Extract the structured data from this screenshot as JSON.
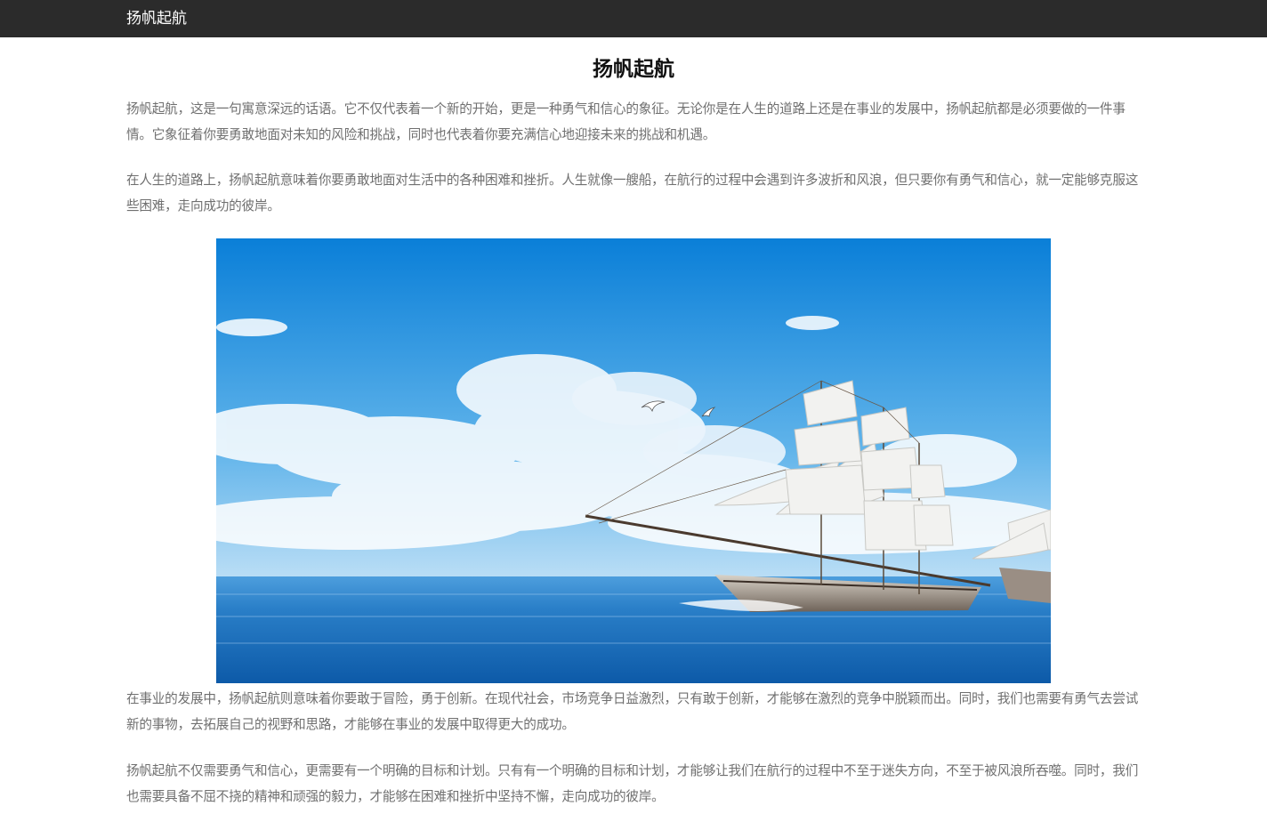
{
  "header": {
    "brand": "扬帆起航"
  },
  "article": {
    "title": "扬帆起航",
    "paragraphs": [
      "扬帆起航，这是一句寓意深远的话语。它不仅代表着一个新的开始，更是一种勇气和信心的象征。无论你是在人生的道路上还是在事业的发展中，扬帆起航都是必须要做的一件事情。它象征着你要勇敢地面对未知的风险和挑战，同时也代表着你要充满信心地迎接未来的挑战和机遇。",
      "在人生的道路上，扬帆起航意味着你要勇敢地面对生活中的各种困难和挫折。人生就像一艘船，在航行的过程中会遇到许多波折和风浪，但只要你有勇气和信心，就一定能够克服这些困难，走向成功的彼岸。",
      "在事业的发展中，扬帆起航则意味着你要敢于冒险，勇于创新。在现代社会，市场竞争日益激烈，只有敢于创新，才能够在激烈的竞争中脱颖而出。同时，我们也需要有勇气去尝试新的事物，去拓展自己的视野和思路，才能够在事业的发展中取得更大的成功。",
      "扬帆起航不仅需要勇气和信心，更需要有一个明确的目标和计划。只有有一个明确的目标和计划，才能够让我们在航行的过程中不至于迷失方向，不至于被风浪所吞噬。同时，我们也需要具备不屈不挠的精神和顽强的毅力，才能够在困难和挫折中坚持不懈，走向成功的彼岸。"
    ]
  },
  "colors": {
    "header_bg": "#2b2b2b",
    "header_text": "#ffffff",
    "body_text": "#6f6f6f",
    "title_text": "#111111",
    "sky_top": "#0a7fd8",
    "sea": "#2a7fc8"
  }
}
